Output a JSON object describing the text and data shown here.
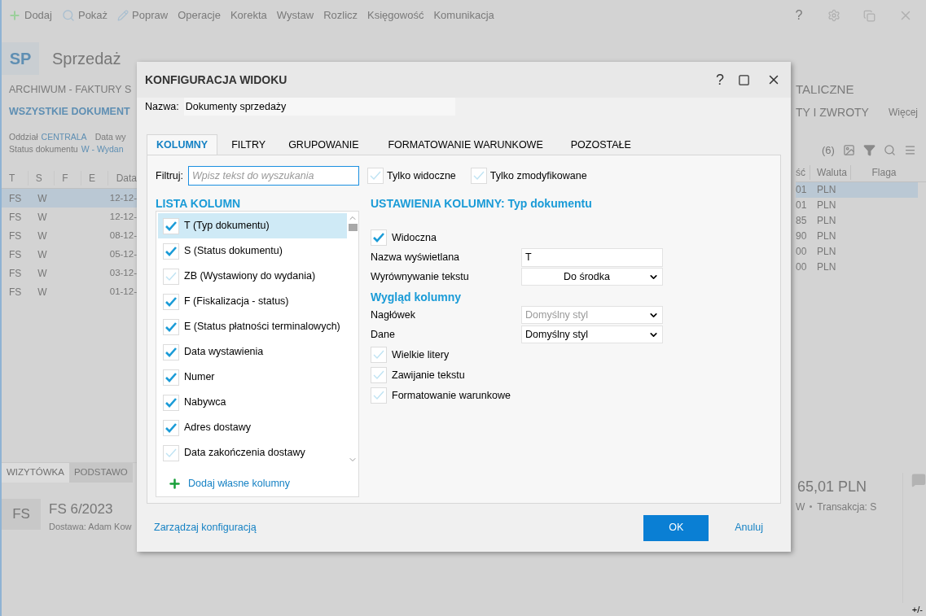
{
  "toolbar": {
    "items": [
      {
        "kind": "add",
        "label": "Dodaj"
      },
      {
        "kind": "search",
        "label": "Pokaż"
      },
      {
        "kind": "edit",
        "label": "Popraw"
      },
      {
        "kind": "text",
        "label": "Operacje"
      },
      {
        "kind": "text",
        "label": "Korekta"
      },
      {
        "kind": "text",
        "label": "Wystaw"
      },
      {
        "kind": "text",
        "label": "Rozlicz"
      },
      {
        "kind": "text",
        "label": "Księgowość"
      },
      {
        "kind": "text",
        "label": "Komunikacja"
      }
    ],
    "help": "?"
  },
  "module": {
    "badge": "SP",
    "title": "Sprzedaż"
  },
  "left_pane": {
    "section": "ARCHIWUM - FAKTURY S",
    "view": "WSZYSTKIE DOKUMENT",
    "filter_1_label": "Oddział",
    "filter_1_value": "CENTRALA",
    "filter_1_next": "Data wy",
    "filter_2_label": "Status dokumentu",
    "filter_2_value": "W - Wydan",
    "columns": [
      "T",
      "S",
      "F",
      "E",
      "Data"
    ],
    "rows": [
      {
        "t": "FS",
        "s": "W",
        "date": "12-12-",
        "selected": true
      },
      {
        "t": "FS",
        "s": "W",
        "date": "12-12-",
        "selected": false
      },
      {
        "t": "FS",
        "s": "W",
        "date": "08-12-",
        "selected": false
      },
      {
        "t": "FS",
        "s": "W",
        "date": "05-12-",
        "selected": false
      },
      {
        "t": "FS",
        "s": "W",
        "date": "03-12-",
        "selected": false
      },
      {
        "t": "FS",
        "s": "W",
        "date": "01-12-",
        "selected": false
      }
    ],
    "bottom_tabs": [
      {
        "label": "WIZYTÓWKA",
        "selected": true
      },
      {
        "label": "PODSTAWO",
        "selected": false
      }
    ],
    "card_badge": "FS",
    "card_title": "FS 6/2023",
    "card_subtitle": "Dostawa: Adam Kow"
  },
  "right_pane": {
    "section": "TALICZNE",
    "view": "TY I ZWROTY",
    "more": "Więcej",
    "count": "(6)",
    "columns": [
      "ść",
      "Waluta",
      "Flaga"
    ],
    "rows": [
      {
        "amount": "01",
        "currency": "PLN",
        "selected": true
      },
      {
        "amount": "01",
        "currency": "PLN",
        "selected": false
      },
      {
        "amount": "85",
        "currency": "PLN",
        "selected": false
      },
      {
        "amount": "90",
        "currency": "PLN",
        "selected": false
      },
      {
        "amount": "00",
        "currency": "PLN",
        "selected": false
      },
      {
        "amount": "00",
        "currency": "PLN",
        "selected": false
      }
    ],
    "card_amount": "65,01 PLN",
    "card_status": "W",
    "card_transaction": "Transakcja:  S",
    "corner": "+/-"
  },
  "dialog": {
    "title": "KONFIGURACJA WIDOKU",
    "help": "?",
    "name_label": "Nazwa:",
    "name_value": "Dokumenty sprzedaży",
    "tabs": [
      {
        "label": "KOLUMNY",
        "selected": true
      },
      {
        "label": "FILTRY",
        "selected": false
      },
      {
        "label": "GRUPOWANIE",
        "selected": false
      },
      {
        "label": "FORMATOWANIE WARUNKOWE",
        "selected": false
      },
      {
        "label": "POZOSTAŁE",
        "selected": false
      }
    ],
    "filter_label": "Filtruj:",
    "filter_placeholder": "Wpisz tekst do wyszukania",
    "only_visible": {
      "label": "Tylko widoczne",
      "checked": false
    },
    "only_modified": {
      "label": "Tylko zmodyfikowane",
      "checked": false
    },
    "list_title": "LISTA KOLUMN",
    "columns": [
      {
        "label": "T (Typ dokumentu)",
        "checked": true,
        "selected": true
      },
      {
        "label": "S (Status dokumentu)",
        "checked": true,
        "selected": false
      },
      {
        "label": "ZB (Wystawiony do wydania)",
        "checked": false,
        "selected": false
      },
      {
        "label": "F (Fiskalizacja - status)",
        "checked": true,
        "selected": false
      },
      {
        "label": "E (Status płatności terminalowych)",
        "checked": true,
        "selected": false
      },
      {
        "label": "Data wystawienia",
        "checked": true,
        "selected": false
      },
      {
        "label": "Numer",
        "checked": true,
        "selected": false
      },
      {
        "label": "Nabywca",
        "checked": true,
        "selected": false
      },
      {
        "label": "Adres dostawy",
        "checked": true,
        "selected": false
      },
      {
        "label": "Data zakończenia dostawy",
        "checked": false,
        "selected": false
      }
    ],
    "add_columns": "Dodaj własne kolumny",
    "settings_title": "USTAWIENIA KOLUMNY: Typ dokumentu",
    "visible": {
      "label": "Widoczna",
      "checked": true
    },
    "display_name_label": "Nazwa wyświetlana",
    "display_name_value": "T",
    "align_label": "Wyrównywanie tekstu",
    "align_value": "Do środka",
    "look_title": "Wygląd kolumny",
    "header_style": {
      "label": "Nagłówek",
      "value": "Domyślny styl",
      "disabled": true
    },
    "data_style": {
      "label": "Dane",
      "value": "Domyślny styl",
      "disabled": false
    },
    "options": [
      {
        "label": "Wielkie litery",
        "checked": false
      },
      {
        "label": "Zawijanie tekstu",
        "checked": false
      },
      {
        "label": "Formatowanie warunkowe",
        "checked": false
      }
    ],
    "manage": "Zarządzaj konfiguracją",
    "ok": "OK",
    "cancel": "Anuluj"
  }
}
